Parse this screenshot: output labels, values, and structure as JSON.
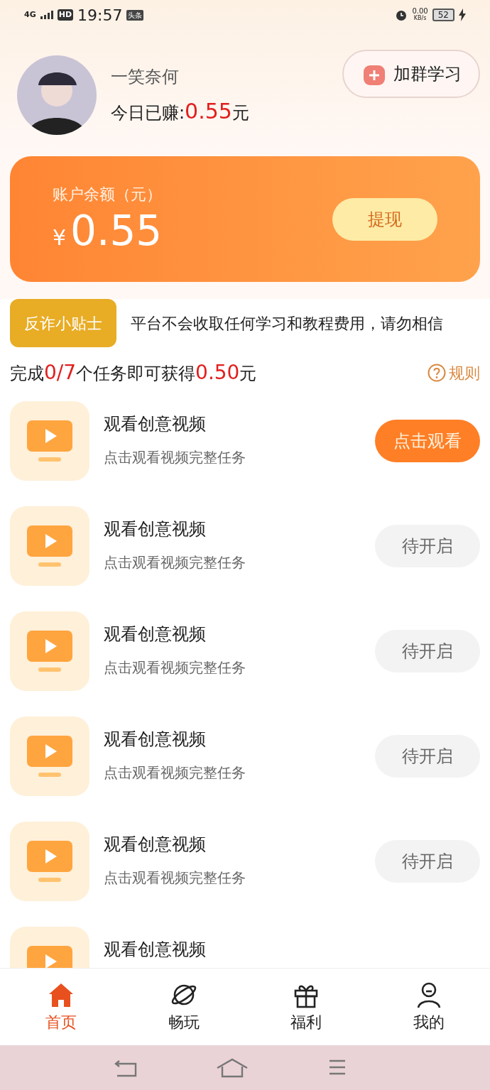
{
  "status_bar": {
    "network": "4G",
    "hd": "HD",
    "time": "19:57",
    "app_badge": "头条",
    "speed": "0.00",
    "speed_unit": "KB/s",
    "battery": "52"
  },
  "profile": {
    "name": "一笑奈何",
    "earned_label": "今日已赚:",
    "earned_value": "0.55",
    "earned_unit": "元"
  },
  "join_button": "加群学习",
  "balance_card": {
    "label": "账户余额（元）",
    "currency": "¥",
    "amount": "0.55",
    "withdraw_button": "提现"
  },
  "tip": {
    "badge": "反诈小贴士",
    "text": "平台不会收取任何学习和教程费用，请勿相信"
  },
  "summary": {
    "prefix": "完成",
    "progress": "0/7",
    "middle": "个任务即可获得",
    "reward": "0.50",
    "suffix": "元",
    "rules_link": "规则"
  },
  "tasks": [
    {
      "title": "观看创意视频",
      "subtitle": "点击观看视频完整任务",
      "button": "点击观看",
      "disabled": false
    },
    {
      "title": "观看创意视频",
      "subtitle": "点击观看视频完整任务",
      "button": "待开启",
      "disabled": true
    },
    {
      "title": "观看创意视频",
      "subtitle": "点击观看视频完整任务",
      "button": "待开启",
      "disabled": true
    },
    {
      "title": "观看创意视频",
      "subtitle": "点击观看视频完整任务",
      "button": "待开启",
      "disabled": true
    },
    {
      "title": "观看创意视频",
      "subtitle": "点击观看视频完整任务",
      "button": "待开启",
      "disabled": true
    },
    {
      "title": "观看创意视频"
    }
  ],
  "bottom_nav": [
    {
      "label": "首页",
      "selected": true
    },
    {
      "label": "畅玩",
      "selected": false
    },
    {
      "label": "福利",
      "selected": false
    },
    {
      "label": "我的",
      "selected": false
    }
  ]
}
